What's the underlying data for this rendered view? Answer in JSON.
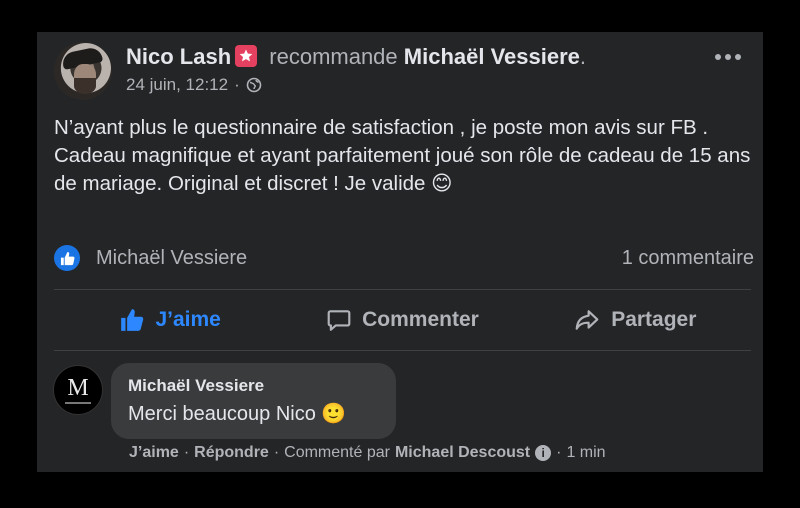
{
  "post": {
    "author": "Nico Lash",
    "verb": "recommande",
    "target": "Michaël Vessiere",
    "target_suffix": ".",
    "date": "24 juin, 12:12",
    "date_separator": "·",
    "privacy_icon": "globe-icon",
    "text_lines": [
      "N’ayant plus le questionnaire de satisfaction , je poste mon avis sur FB .",
      "Cadeau magnifique et ayant parfaitement joué son rôle de cadeau de 15 ans de mariage.  Original et discret ! Je valide 😊"
    ]
  },
  "reactions": {
    "icon": "like-icon",
    "name": "Michaël Vessiere",
    "comment_count": "1 commentaire"
  },
  "actions": {
    "like": "J’aime",
    "comment": "Commenter",
    "share": "Partager"
  },
  "comment": {
    "author": "Michaël Vessiere",
    "avatar_letter": "M",
    "text": "Merci beaucoup Nico 🙂",
    "like": "J’aime",
    "sep": "·",
    "reply": "Répondre",
    "commented_by": "Commenté par",
    "commenter": "Michael Descoust",
    "time": "1 min"
  },
  "colors": {
    "background": "#000000",
    "card": "#242526",
    "bubble": "#3a3b3c",
    "accent_blue": "#2d88ff",
    "badge_pink": "#e4405f",
    "secondary_text": "#b0b3b8"
  }
}
